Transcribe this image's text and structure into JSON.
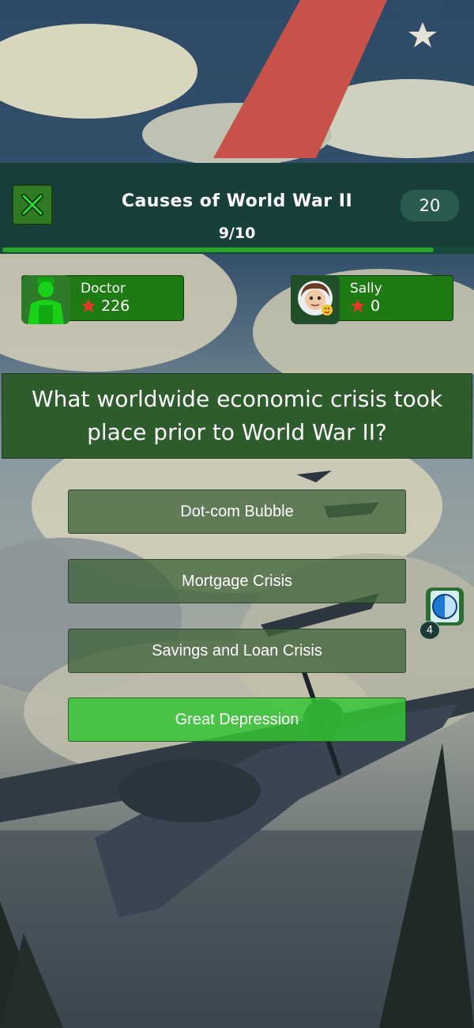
{
  "header": {
    "title": "Causes of World War II",
    "progress_text": "9/10",
    "progress_fraction": 0.92,
    "timer": "20"
  },
  "players": [
    {
      "name": "Doctor",
      "score": "226",
      "avatar_icon": "person-icon"
    },
    {
      "name": "Sally",
      "score": "0",
      "avatar_icon": "avatar-face-icon"
    }
  ],
  "question": "What worldwide economic crisis took place prior to World War II?",
  "answers": [
    {
      "label": "Dot-com Bubble",
      "state": "neutral"
    },
    {
      "label": "Mortgage Crisis",
      "state": "neutral"
    },
    {
      "label": "Savings and Loan Crisis",
      "state": "neutral"
    },
    {
      "label": "Great Depression",
      "state": "correct"
    }
  ],
  "powerup": {
    "icon": "globe-icon",
    "count": "4"
  },
  "colors": {
    "header_bg": "#183f3b",
    "player_card": "#1e7a12",
    "correct_answer": "#34c434",
    "star": "#e23a2a"
  }
}
